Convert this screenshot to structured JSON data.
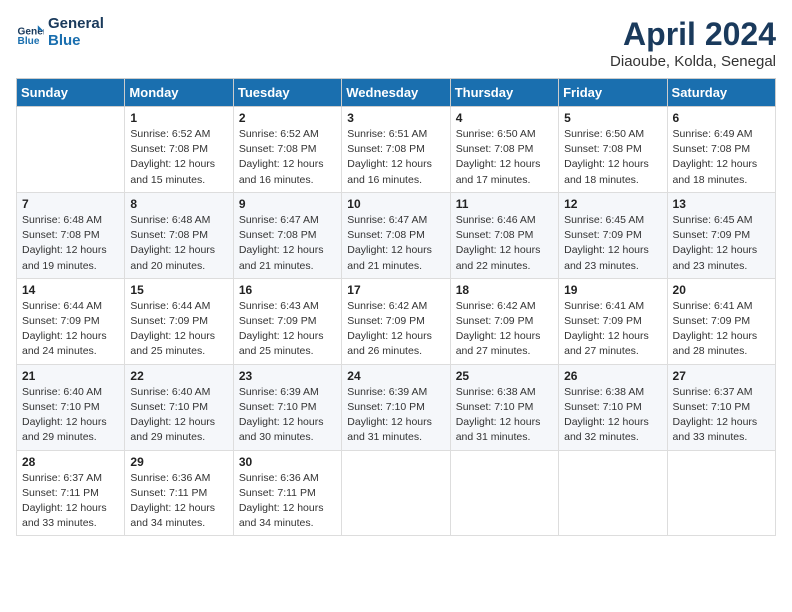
{
  "header": {
    "logo_line1": "General",
    "logo_line2": "Blue",
    "title": "April 2024",
    "subtitle": "Diaoube, Kolda, Senegal"
  },
  "days_header": [
    "Sunday",
    "Monday",
    "Tuesday",
    "Wednesday",
    "Thursday",
    "Friday",
    "Saturday"
  ],
  "weeks": [
    [
      {
        "num": "",
        "info": ""
      },
      {
        "num": "1",
        "info": "Sunrise: 6:52 AM\nSunset: 7:08 PM\nDaylight: 12 hours\nand 15 minutes."
      },
      {
        "num": "2",
        "info": "Sunrise: 6:52 AM\nSunset: 7:08 PM\nDaylight: 12 hours\nand 16 minutes."
      },
      {
        "num": "3",
        "info": "Sunrise: 6:51 AM\nSunset: 7:08 PM\nDaylight: 12 hours\nand 16 minutes."
      },
      {
        "num": "4",
        "info": "Sunrise: 6:50 AM\nSunset: 7:08 PM\nDaylight: 12 hours\nand 17 minutes."
      },
      {
        "num": "5",
        "info": "Sunrise: 6:50 AM\nSunset: 7:08 PM\nDaylight: 12 hours\nand 18 minutes."
      },
      {
        "num": "6",
        "info": "Sunrise: 6:49 AM\nSunset: 7:08 PM\nDaylight: 12 hours\nand 18 minutes."
      }
    ],
    [
      {
        "num": "7",
        "info": "Sunrise: 6:48 AM\nSunset: 7:08 PM\nDaylight: 12 hours\nand 19 minutes."
      },
      {
        "num": "8",
        "info": "Sunrise: 6:48 AM\nSunset: 7:08 PM\nDaylight: 12 hours\nand 20 minutes."
      },
      {
        "num": "9",
        "info": "Sunrise: 6:47 AM\nSunset: 7:08 PM\nDaylight: 12 hours\nand 21 minutes."
      },
      {
        "num": "10",
        "info": "Sunrise: 6:47 AM\nSunset: 7:08 PM\nDaylight: 12 hours\nand 21 minutes."
      },
      {
        "num": "11",
        "info": "Sunrise: 6:46 AM\nSunset: 7:08 PM\nDaylight: 12 hours\nand 22 minutes."
      },
      {
        "num": "12",
        "info": "Sunrise: 6:45 AM\nSunset: 7:09 PM\nDaylight: 12 hours\nand 23 minutes."
      },
      {
        "num": "13",
        "info": "Sunrise: 6:45 AM\nSunset: 7:09 PM\nDaylight: 12 hours\nand 23 minutes."
      }
    ],
    [
      {
        "num": "14",
        "info": "Sunrise: 6:44 AM\nSunset: 7:09 PM\nDaylight: 12 hours\nand 24 minutes."
      },
      {
        "num": "15",
        "info": "Sunrise: 6:44 AM\nSunset: 7:09 PM\nDaylight: 12 hours\nand 25 minutes."
      },
      {
        "num": "16",
        "info": "Sunrise: 6:43 AM\nSunset: 7:09 PM\nDaylight: 12 hours\nand 25 minutes."
      },
      {
        "num": "17",
        "info": "Sunrise: 6:42 AM\nSunset: 7:09 PM\nDaylight: 12 hours\nand 26 minutes."
      },
      {
        "num": "18",
        "info": "Sunrise: 6:42 AM\nSunset: 7:09 PM\nDaylight: 12 hours\nand 27 minutes."
      },
      {
        "num": "19",
        "info": "Sunrise: 6:41 AM\nSunset: 7:09 PM\nDaylight: 12 hours\nand 27 minutes."
      },
      {
        "num": "20",
        "info": "Sunrise: 6:41 AM\nSunset: 7:09 PM\nDaylight: 12 hours\nand 28 minutes."
      }
    ],
    [
      {
        "num": "21",
        "info": "Sunrise: 6:40 AM\nSunset: 7:10 PM\nDaylight: 12 hours\nand 29 minutes."
      },
      {
        "num": "22",
        "info": "Sunrise: 6:40 AM\nSunset: 7:10 PM\nDaylight: 12 hours\nand 29 minutes."
      },
      {
        "num": "23",
        "info": "Sunrise: 6:39 AM\nSunset: 7:10 PM\nDaylight: 12 hours\nand 30 minutes."
      },
      {
        "num": "24",
        "info": "Sunrise: 6:39 AM\nSunset: 7:10 PM\nDaylight: 12 hours\nand 31 minutes."
      },
      {
        "num": "25",
        "info": "Sunrise: 6:38 AM\nSunset: 7:10 PM\nDaylight: 12 hours\nand 31 minutes."
      },
      {
        "num": "26",
        "info": "Sunrise: 6:38 AM\nSunset: 7:10 PM\nDaylight: 12 hours\nand 32 minutes."
      },
      {
        "num": "27",
        "info": "Sunrise: 6:37 AM\nSunset: 7:10 PM\nDaylight: 12 hours\nand 33 minutes."
      }
    ],
    [
      {
        "num": "28",
        "info": "Sunrise: 6:37 AM\nSunset: 7:11 PM\nDaylight: 12 hours\nand 33 minutes."
      },
      {
        "num": "29",
        "info": "Sunrise: 6:36 AM\nSunset: 7:11 PM\nDaylight: 12 hours\nand 34 minutes."
      },
      {
        "num": "30",
        "info": "Sunrise: 6:36 AM\nSunset: 7:11 PM\nDaylight: 12 hours\nand 34 minutes."
      },
      {
        "num": "",
        "info": ""
      },
      {
        "num": "",
        "info": ""
      },
      {
        "num": "",
        "info": ""
      },
      {
        "num": "",
        "info": ""
      }
    ]
  ]
}
